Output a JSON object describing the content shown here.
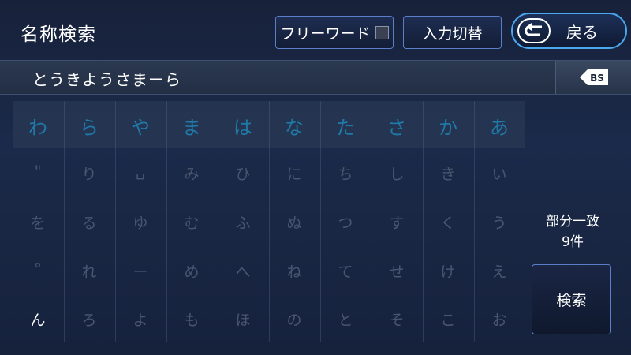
{
  "header": {
    "title": "名称検索",
    "free_word_label": "フリーワード",
    "input_switch_label": "入力切替",
    "back_label": "戻る"
  },
  "input": {
    "text": "とうきようさまーら",
    "backspace_label": "BS"
  },
  "keyboard": {
    "columns": [
      {
        "head": "わ",
        "keys": [
          "\"",
          "を",
          "°",
          "ん"
        ]
      },
      {
        "head": "ら",
        "keys": [
          "り",
          "る",
          "れ",
          "ろ"
        ]
      },
      {
        "head": "や",
        "keys": [
          "␣",
          "ゆ",
          "ー",
          "よ"
        ]
      },
      {
        "head": "ま",
        "keys": [
          "み",
          "む",
          "め",
          "も"
        ]
      },
      {
        "head": "は",
        "keys": [
          "ひ",
          "ふ",
          "へ",
          "ほ"
        ]
      },
      {
        "head": "な",
        "keys": [
          "に",
          "ぬ",
          "ね",
          "の"
        ]
      },
      {
        "head": "た",
        "keys": [
          "ち",
          "つ",
          "て",
          "と"
        ]
      },
      {
        "head": "さ",
        "keys": [
          "し",
          "す",
          "せ",
          "そ"
        ]
      },
      {
        "head": "か",
        "keys": [
          "き",
          "く",
          "け",
          "こ"
        ]
      },
      {
        "head": "あ",
        "keys": [
          "い",
          "う",
          "え",
          "お"
        ]
      }
    ],
    "active_key": "ん"
  },
  "status": {
    "match_type": "部分一致",
    "count": "9件"
  },
  "search_button_label": "検索"
}
